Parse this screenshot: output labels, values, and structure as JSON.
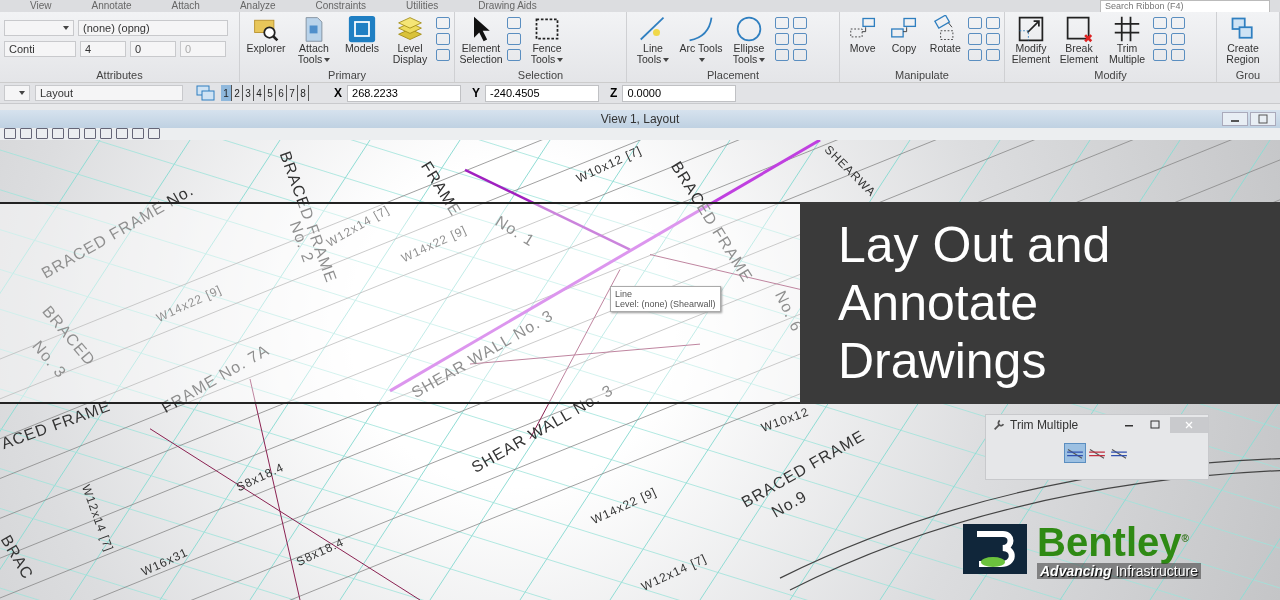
{
  "ribbon_tabs": [
    {
      "label": "View"
    },
    {
      "label": "Annotate"
    },
    {
      "label": "Attach"
    },
    {
      "label": "Analyze"
    },
    {
      "label": "Constraints"
    },
    {
      "label": "Utilities"
    },
    {
      "label": "Drawing Aids"
    }
  ],
  "search": {
    "placeholder": "Search Ribbon (F4)"
  },
  "attributes": {
    "label": "Attributes",
    "level": "(none) (opng)",
    "line_style": "Conti",
    "weight": "4",
    "color_number": "0",
    "transparency": "0"
  },
  "groups": [
    {
      "label": "Primary",
      "buttons": [
        {
          "label": "Explorer",
          "dropdown": false
        },
        {
          "label": "Attach Tools",
          "dropdown": true
        },
        {
          "label": "Models",
          "dropdown": false
        },
        {
          "label": "Level Display",
          "dropdown": false
        }
      ]
    },
    {
      "label": "Selection",
      "buttons": [
        {
          "label": "Element Selection",
          "dropdown": false
        },
        {
          "label": "Fence Tools",
          "dropdown": true
        }
      ]
    },
    {
      "label": "Placement",
      "buttons": [
        {
          "label": "Line Tools",
          "dropdown": true
        },
        {
          "label": "Arc Tools",
          "dropdown": true
        },
        {
          "label": "Ellipse Tools",
          "dropdown": true
        }
      ]
    },
    {
      "label": "Manipulate",
      "buttons": [
        {
          "label": "Move",
          "dropdown": false
        },
        {
          "label": "Copy",
          "dropdown": false
        },
        {
          "label": "Rotate",
          "dropdown": false
        }
      ]
    },
    {
      "label": "Modify",
      "buttons": [
        {
          "label": "Modify Element",
          "dropdown": false
        },
        {
          "label": "Break Element",
          "dropdown": false
        },
        {
          "label": "Trim Multiple",
          "dropdown": false
        }
      ]
    },
    {
      "label": "Grou",
      "buttons": [
        {
          "label": "Create Region",
          "dropdown": false
        }
      ]
    }
  ],
  "view_bar": {
    "model": "Layout",
    "views": [
      {
        "label": "1",
        "selected": true
      },
      {
        "label": "2",
        "selected": false
      },
      {
        "label": "3",
        "selected": false
      },
      {
        "label": "4",
        "selected": false
      },
      {
        "label": "5",
        "selected": false
      },
      {
        "label": "6",
        "selected": false
      },
      {
        "label": "7",
        "selected": false
      },
      {
        "label": "8",
        "selected": false
      }
    ],
    "coords": [
      {
        "axis": "X",
        "value": "268.2233"
      },
      {
        "axis": "Y",
        "value": "-240.4505"
      },
      {
        "axis": "Z",
        "value": "0.0000"
      }
    ]
  },
  "view_window": {
    "title": "View 1, Layout"
  },
  "drawing_labels": [
    "BRACED FRAME No.",
    "BRACED FRAME",
    "No. 2",
    "W12x14 [7]",
    "FRAME",
    "No. 1",
    "W10x12 [7]",
    "BRACED FRAME",
    "No. 6",
    "W14x22 [9]",
    "W14x22 [9]",
    "BRACED",
    "No. 3",
    "FRAME No. 7A",
    "SHEAR WALL No. 3",
    "SHEAR WALL No. 3",
    "ACED FRAME",
    "W10x12",
    "S8x18.4",
    "S8x18.4",
    "W12x14 [7]",
    "W16x31",
    "W14x22 [9]",
    "W12x14 [7]",
    "BRACED FRAME",
    "No.9",
    "BRAC",
    "SHEARWA"
  ],
  "tooltip": {
    "title": "Line",
    "detail": "Level: (none) (Shearwall)"
  },
  "banner": {
    "title": "Lay Out and Annotate Drawings"
  },
  "trim_dialog": {
    "title": "Trim Multiple",
    "modes": [
      {
        "selected": true
      },
      {
        "selected": false
      },
      {
        "selected": false
      }
    ]
  },
  "logo": {
    "name": "Bentley",
    "mark": "®",
    "tagline": "**Advancing** Infrastructure"
  }
}
